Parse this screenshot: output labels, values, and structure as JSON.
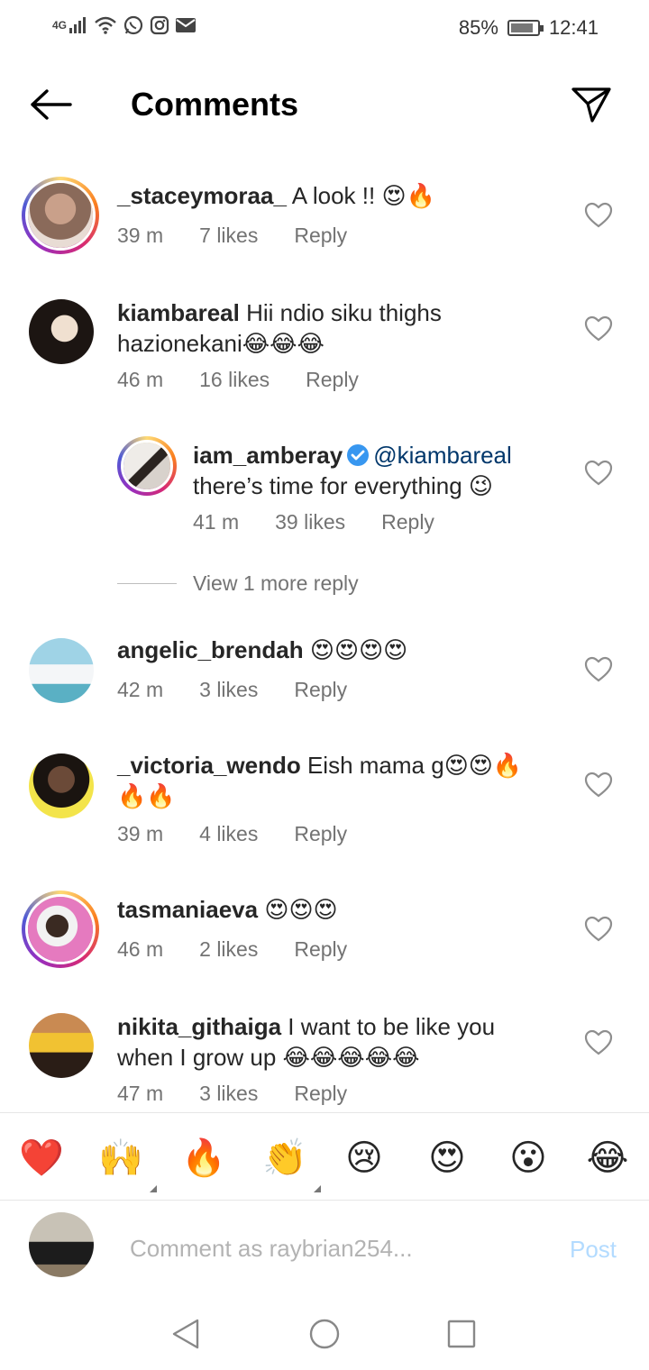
{
  "status_bar": {
    "network": "4G",
    "battery_percent": "85%",
    "battery_level": 0.85,
    "time": "12:41",
    "icons": [
      "signal-icon",
      "wifi-icon",
      "whatsapp-icon",
      "instagram-icon",
      "mail-icon"
    ]
  },
  "header": {
    "title": "Comments"
  },
  "comments": [
    {
      "username": "_staceymoraa_",
      "text": "A look !! 😍🔥",
      "time": "39 m",
      "likes": "7 likes",
      "reply": "Reply",
      "avatar_ring": true,
      "avatar_color": "#b08a76"
    },
    {
      "username": "kiambareal",
      "text": "Hii ndio siku thighs hazionekani😂😂😂",
      "time": "46 m",
      "likes": "16 likes",
      "reply": "Reply",
      "avatar_ring": false,
      "avatar_color": "#3a2d26"
    },
    {
      "username": "iam_amberay",
      "mention": "@kiambareal",
      "text": "there’s time for everything 😉",
      "time": "41 m",
      "likes": "39 likes",
      "reply": "Reply",
      "avatar_ring": true,
      "avatar_color": "#c8c2bd",
      "verified": true
    },
    {
      "username": "angelic_brendah",
      "text": "😍😍😍😍",
      "time": "42 m",
      "likes": "3 likes",
      "reply": "Reply",
      "avatar_ring": false,
      "avatar_color": "#6fb4c6"
    },
    {
      "username": "_victoria_wendo",
      "text": "Eish mama g😍😍🔥🔥🔥",
      "time": "39 m",
      "likes": "4 likes",
      "reply": "Reply",
      "avatar_ring": false,
      "avatar_color": "#d8c23a"
    },
    {
      "username": "tasmaniaeva",
      "text": "😍😍😍",
      "time": "46 m",
      "likes": "2 likes",
      "reply": "Reply",
      "avatar_ring": true,
      "avatar_color": "#d25fa5"
    },
    {
      "username": "nikita_githaiga",
      "text": "I want to be like you when I grow up 😂😂😂😂😂",
      "time": "47 m",
      "likes": "3 likes",
      "reply": "Reply",
      "avatar_ring": false,
      "avatar_color": "#b46a3c"
    }
  ],
  "view_more_replies": "View 1 more reply",
  "reactions": [
    "❤️",
    "🙌",
    "🔥",
    "👏",
    "😢",
    "😍",
    "😮",
    "😂"
  ],
  "compose": {
    "placeholder": "Comment as raybrian254...",
    "post_label": "Post"
  },
  "colors": {
    "text_primary": "#262626",
    "text_secondary": "#737373",
    "mention": "#00376b",
    "verified": "#3897f0",
    "post_disabled": "#b3dbff"
  }
}
